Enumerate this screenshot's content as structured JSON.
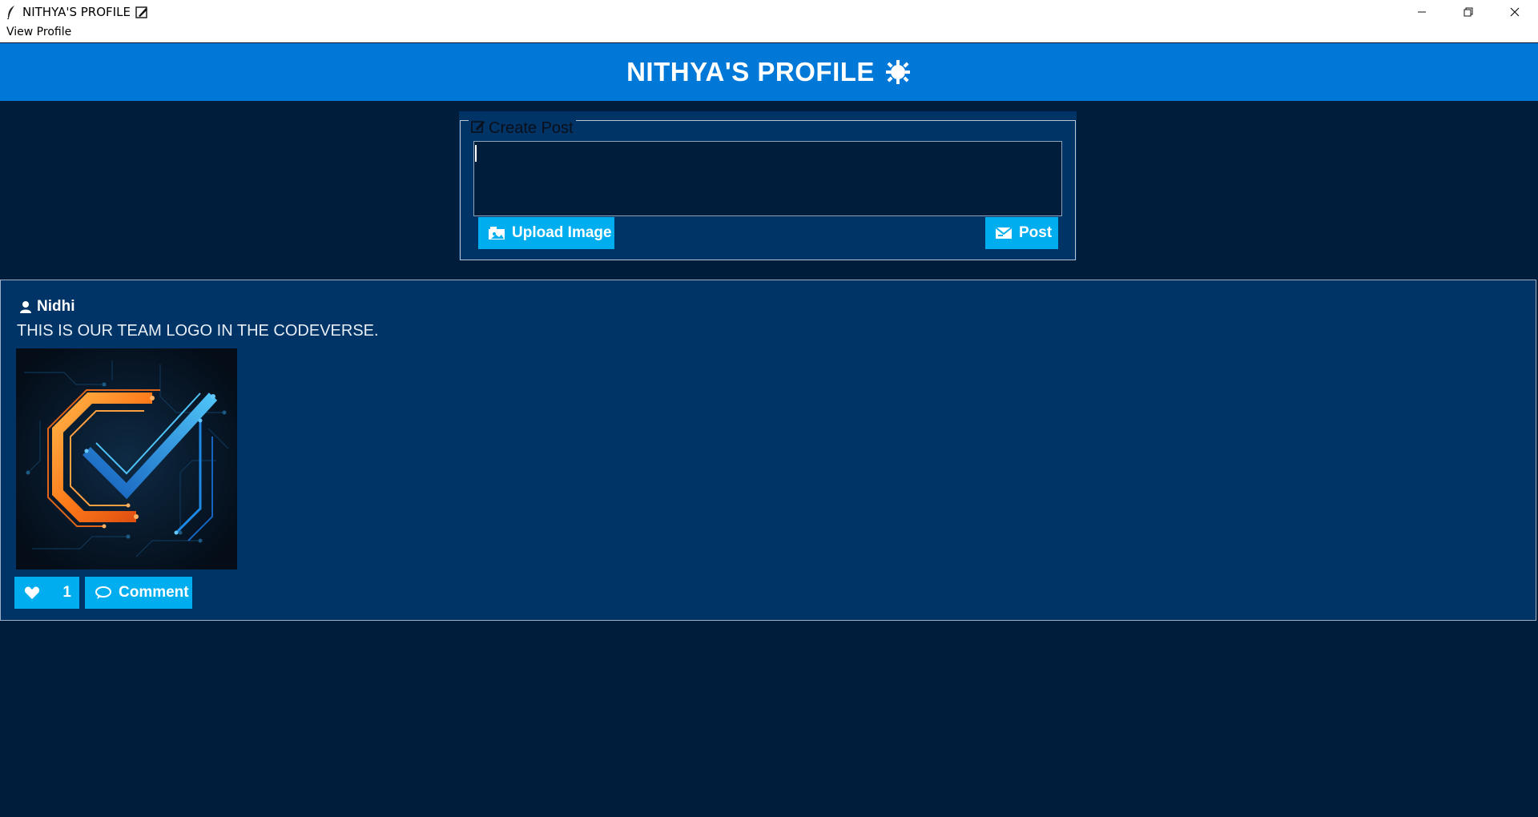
{
  "window": {
    "title": "NITHYA'S PROFILE",
    "title_icon": "memo-pencil-emoji",
    "controls": [
      "minimize",
      "restore",
      "close"
    ]
  },
  "menu": {
    "items": [
      "View Profile"
    ]
  },
  "header": {
    "title": "NITHYA'S PROFILE",
    "icon": "sun-gear-icon",
    "background": "#0078d7"
  },
  "create_post": {
    "legend": "Create Post",
    "legend_icon": "edit-icon",
    "input_value": "",
    "upload_label": "Upload Image",
    "post_label": "Post"
  },
  "posts": [
    {
      "author": "Nidhi",
      "text": "THIS IS OUR TEAM LOGO IN THE CODEVERSE.",
      "image_desc": "circuit-style C with checkmark logo",
      "likes": "1",
      "comment_label": "Comment"
    }
  ],
  "colors": {
    "background": "#001e3c",
    "panel": "#003366",
    "accent": "#00aeef",
    "header": "#0078d7"
  }
}
